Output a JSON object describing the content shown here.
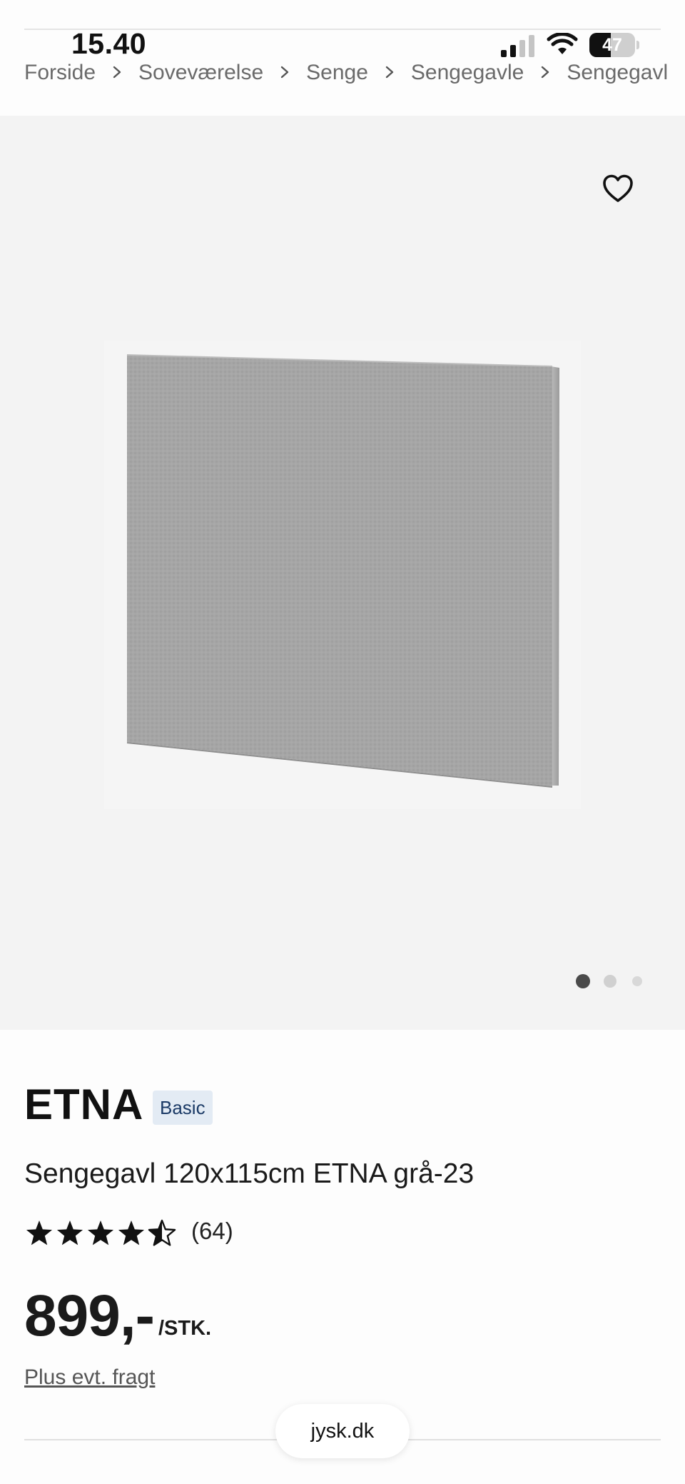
{
  "status_bar": {
    "time": "15.40",
    "battery": "47",
    "battery_level_percent": 47
  },
  "breadcrumb": [
    {
      "label": "Forside"
    },
    {
      "label": "Soveværelse"
    },
    {
      "label": "Senge"
    },
    {
      "label": "Sengegavle"
    },
    {
      "label": "Sengegavl"
    }
  ],
  "gallery": {
    "favorite_icon": "heart-outline-icon",
    "image_count": 3,
    "active_index": 1
  },
  "product": {
    "brand": "ETNA",
    "badge": "Basic",
    "name": "Sengegavl 120x115cm ETNA grå-23",
    "rating": 4.5,
    "review_count": "(64)",
    "price": "899,-",
    "unit": "/STK.",
    "shipping_link": "Plus evt. fragt"
  },
  "browser": {
    "url": "jysk.dk"
  },
  "colors": {
    "badge_bg": "#e3ebf4",
    "badge_text": "#1b3a66",
    "gallery_bg": "#f3f3f3",
    "product_gray": "#a3a3a3"
  }
}
